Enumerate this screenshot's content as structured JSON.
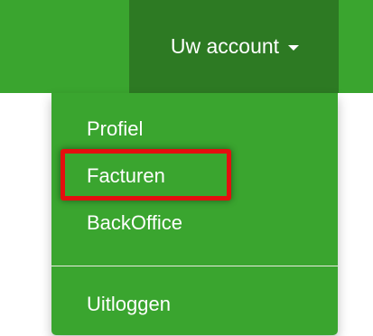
{
  "colors": {
    "navbar_background": "#3aa52f",
    "account_button_background": "#2d7a23",
    "dropdown_background": "#3aa52f",
    "text": "#ffffff",
    "highlight_border": "#e40f0f",
    "divider": "#e7ecdf"
  },
  "navbar": {
    "account_label": "Uw account",
    "caret_icon": "caret-down-icon"
  },
  "dropdown": {
    "items": [
      {
        "label": "Profiel"
      },
      {
        "label": "Facturen",
        "highlighted": true
      },
      {
        "label": "BackOffice"
      },
      {
        "label": "Uitloggen"
      }
    ]
  }
}
